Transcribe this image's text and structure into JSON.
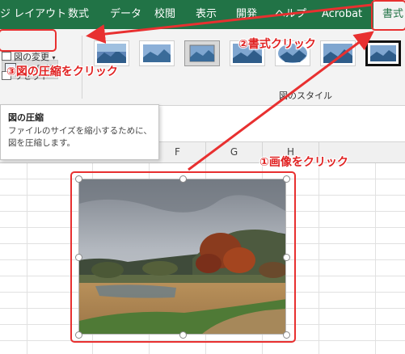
{
  "ribbon": {
    "tabs": [
      {
        "id": "layout",
        "label": "ジ レイアウト"
      },
      {
        "id": "formulas",
        "label": "数式"
      },
      {
        "id": "data",
        "label": "データ"
      },
      {
        "id": "review",
        "label": "校閲"
      },
      {
        "id": "view",
        "label": "表示"
      },
      {
        "id": "developer",
        "label": "開発"
      },
      {
        "id": "help",
        "label": "ヘルプ"
      },
      {
        "id": "acrobat",
        "label": "Acrobat"
      },
      {
        "id": "format",
        "label": "書式"
      }
    ],
    "active_tab": "書式",
    "compress_button": "図の圧縮",
    "change_picture": "図の変更",
    "reset_picture": "リセット",
    "styles_group_label": "図のスタイル"
  },
  "tooltip": {
    "title": "図の圧縮",
    "body": "ファイルのサイズを縮小するために、図を圧縮します。"
  },
  "columns": {
    "f": "F",
    "g": "G",
    "h": "H"
  },
  "annotations": {
    "step1": "①画像をクリック",
    "step2": "②書式クリック",
    "step3": "③図の圧縮をクリック",
    "color": "#e83030"
  },
  "theme": {
    "ribbon_green": "#217346",
    "ribbon_bg": "#f3f3f3"
  }
}
